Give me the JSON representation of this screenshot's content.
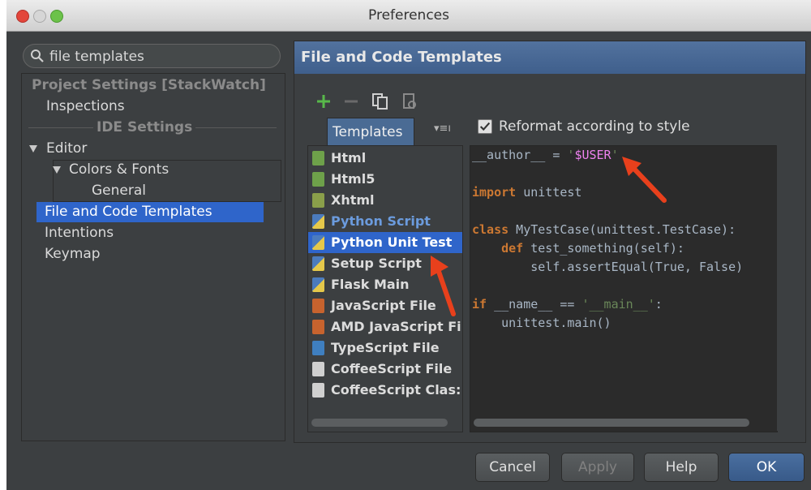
{
  "window": {
    "title": "Preferences"
  },
  "search": {
    "value": "file templates"
  },
  "tree": {
    "project_settings": "Project Settings [StackWatch]",
    "inspections": "Inspections",
    "ide_settings": "IDE Settings",
    "editor": "Editor",
    "colors_fonts": "Colors & Fonts",
    "general": "General",
    "file_code_templates": "File and Code Templates",
    "intentions": "Intentions",
    "keymap": "Keymap"
  },
  "panel": {
    "title": "File and Code Templates",
    "tab": "Templates",
    "reformat_label": "Reformat according to style",
    "reformat_checked": true
  },
  "templates": [
    {
      "label": "Html",
      "icon": "html-file-icon"
    },
    {
      "label": "Html5",
      "icon": "html-file-icon"
    },
    {
      "label": "Xhtml",
      "icon": "xhtml-file-icon"
    },
    {
      "label": "Python Script",
      "icon": "python-file-icon"
    },
    {
      "label": "Python Unit Test",
      "icon": "python-file-icon"
    },
    {
      "label": "Setup Script",
      "icon": "python-file-icon"
    },
    {
      "label": "Flask Main",
      "icon": "python-file-icon"
    },
    {
      "label": "JavaScript File",
      "icon": "javascript-file-icon"
    },
    {
      "label": "AMD JavaScript Fi",
      "icon": "javascript-file-icon"
    },
    {
      "label": "TypeScript File",
      "icon": "typescript-file-icon"
    },
    {
      "label": "CoffeeScript File",
      "icon": "coffeescript-file-icon"
    },
    {
      "label": "CoffeeScript Clas:",
      "icon": "coffeescript-file-icon"
    }
  ],
  "code": {
    "l1a": "__author__ = ",
    "l1b": "'",
    "l1c": "$USER",
    "l1d": "'",
    "l2a": "import",
    "l2b": " unittest",
    "l3a": "class",
    "l3b": " MyTestCase(unittest.TestCase):",
    "l4a": "    def",
    "l4b": " test_something(self):",
    "l5a": "        self.assertEqual(True, False)",
    "l6a": "if",
    "l6b": " __name__ == ",
    "l6c": "'__main__'",
    "l6d": ":",
    "l7a": "    unittest.main()"
  },
  "buttons": {
    "cancel": "Cancel",
    "apply": "Apply",
    "help": "Help",
    "ok": "OK"
  },
  "colors": {
    "selection": "#2f65ca",
    "header": "#4a6b94",
    "arrow": "#e8401c"
  }
}
